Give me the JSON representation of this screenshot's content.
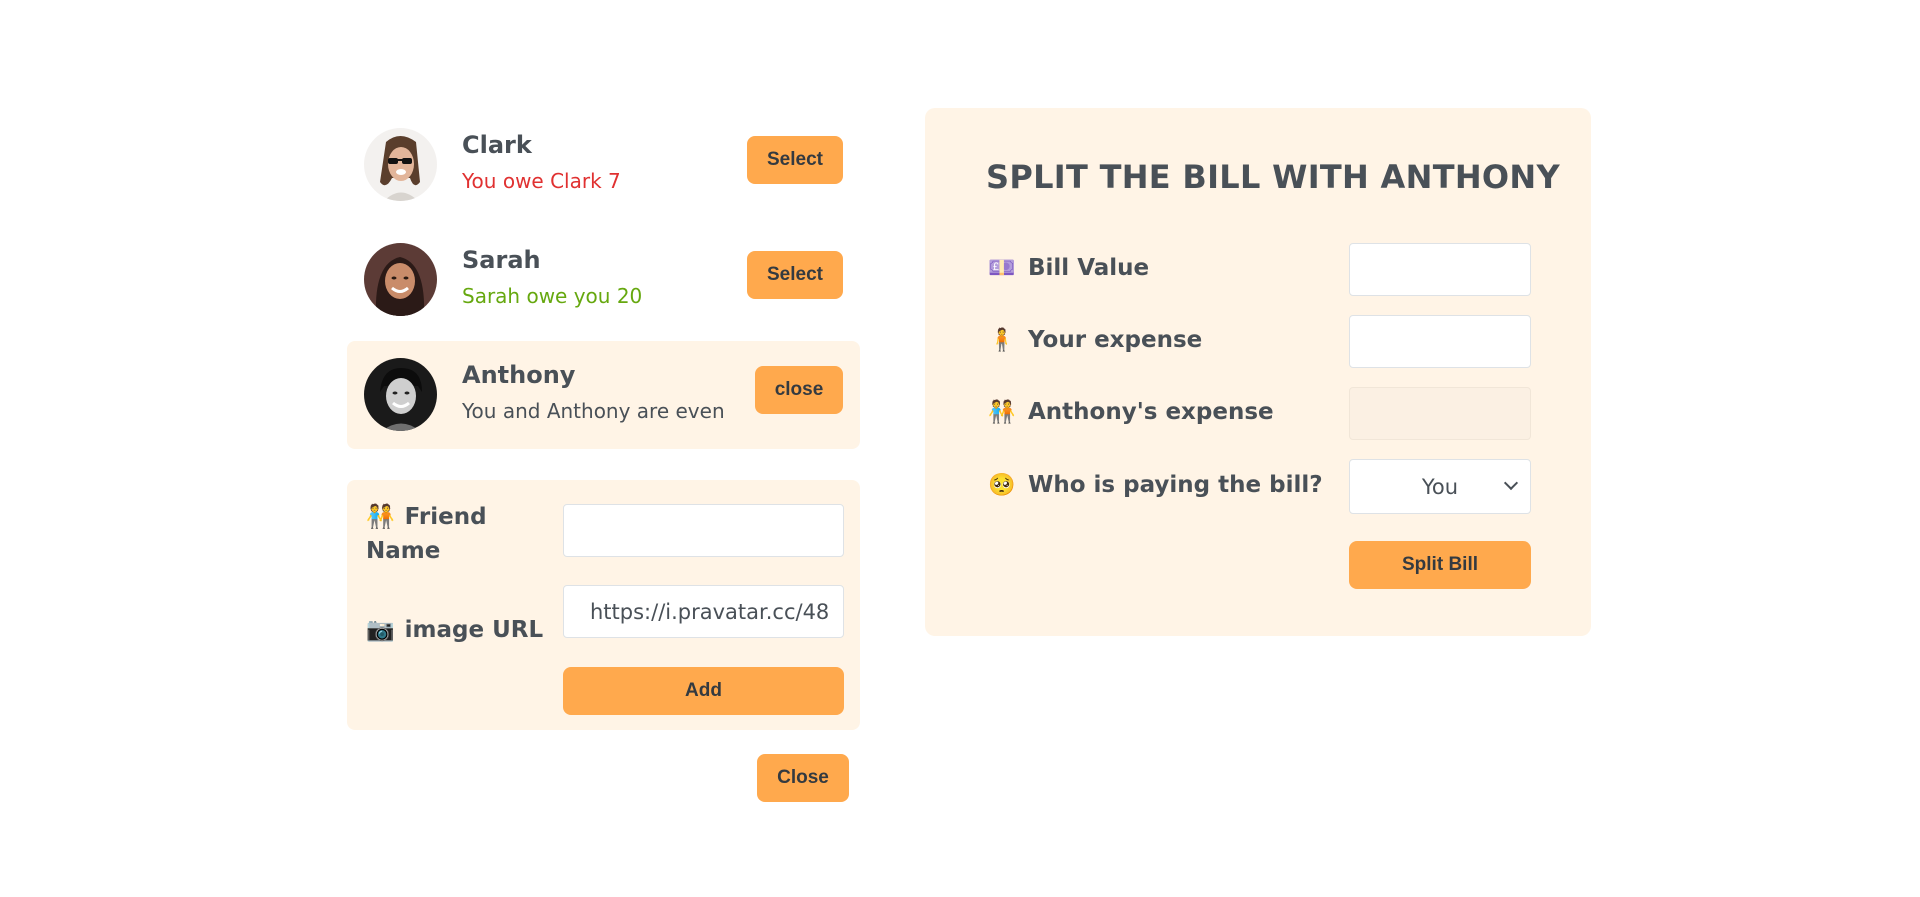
{
  "friends": [
    {
      "name": "Clark",
      "status": "You owe Clark 7",
      "status_color": "#e03131",
      "button": "Select"
    },
    {
      "name": "Sarah",
      "status": "Sarah owe you 20",
      "status_color": "#66a80f",
      "button": "Select"
    },
    {
      "name": "Anthony",
      "status": "You and Anthony are even",
      "status_color": "#495057",
      "button": "close",
      "selected": true
    }
  ],
  "add_friend": {
    "name_icon": "people-holding-hands-icon",
    "name_label": "Friend Name",
    "name_value": "",
    "image_icon": "camera-icon",
    "image_label": "image URL",
    "image_value": "https://i.pravatar.cc/48",
    "add_button": "Add"
  },
  "close_button": "Close",
  "split": {
    "title": "SPLIT THE BILL WITH ANTHONY",
    "bill_icon": "money-bag-icon",
    "bill_label": "Bill Value",
    "bill_value": "",
    "expense_icon": "person-icon",
    "expense_label": "Your expense",
    "expense_value": "",
    "friend_expense_icon": "people-holding-hands-icon",
    "friend_expense_label": "Anthony's expense",
    "friend_expense_value": "",
    "payer_icon": "worried-face-icon",
    "payer_label": "Who is paying the bill?",
    "payer_value": "You",
    "split_button": "Split Bill"
  },
  "colors": {
    "accent": "#ffa94d",
    "panel": "#fff4e6",
    "text": "#495057",
    "owe": "#e03131",
    "owed": "#66a80f"
  }
}
